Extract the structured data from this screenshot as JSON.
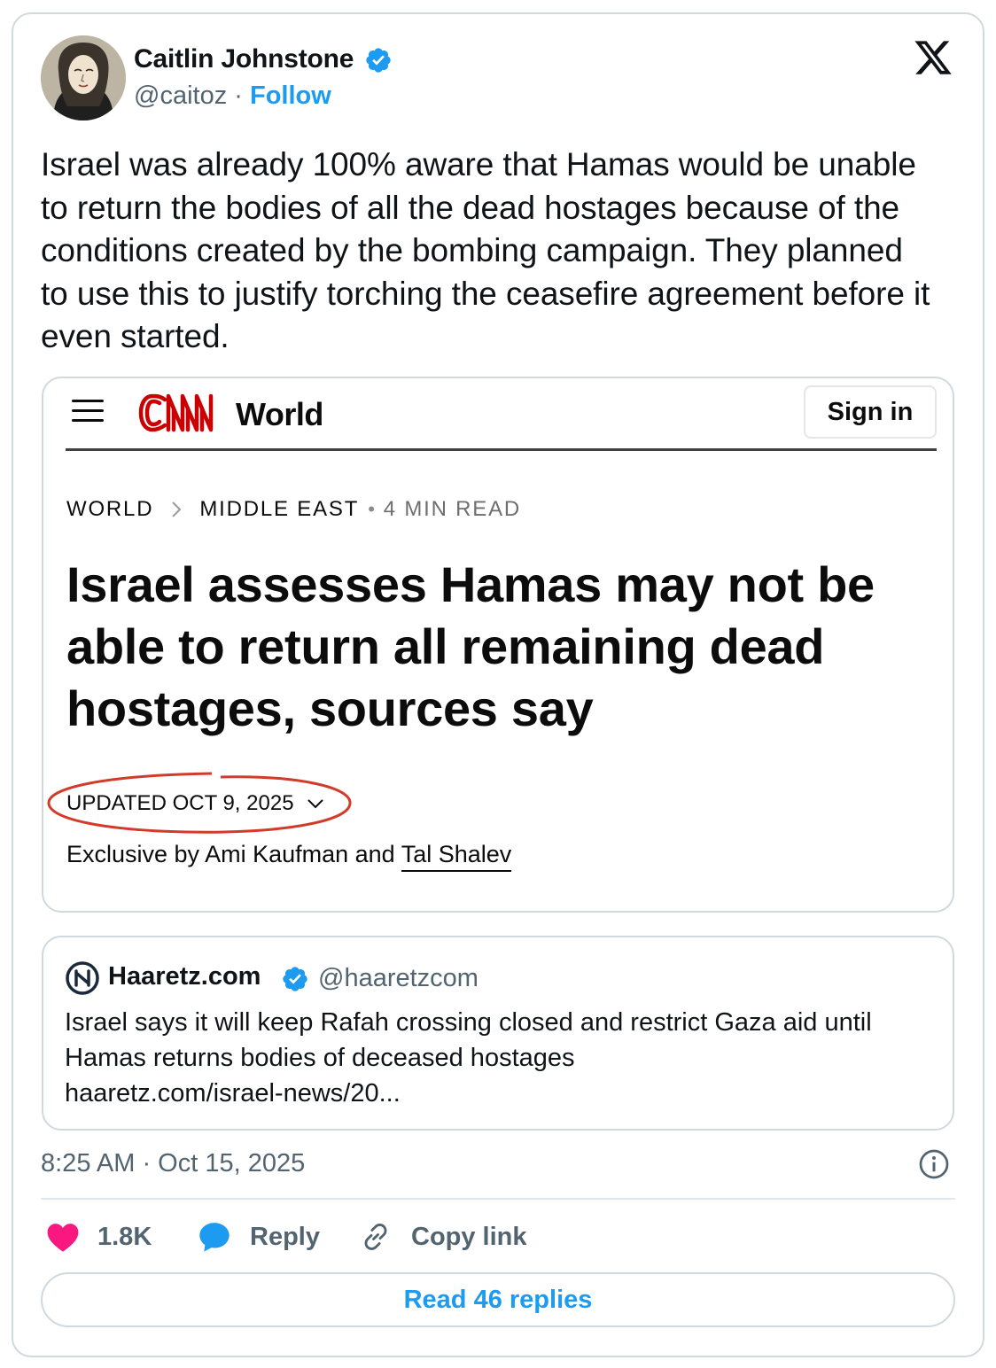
{
  "tweet": {
    "author": {
      "name": "Caitlin Johnstone",
      "handle": "@caitoz",
      "separator": "·",
      "follow_label": "Follow",
      "verified": true
    },
    "text": "Israel was already 100% aware that Hamas would be unable to return the bodies of all the dead hostages because of the conditions created by the bombing campaign. They planned to use this to justify torching the ceasefire agreement before it even started.",
    "timestamp": "8:25 AM · Oct 15, 2025",
    "actions": {
      "likes": "1.8K",
      "reply_label": "Reply",
      "copy_link_label": "Copy link"
    },
    "read_replies_label": "Read 46 replies"
  },
  "embedded_article": {
    "section": "World",
    "sign_in_label": "Sign in",
    "breadcrumb": [
      "WORLD",
      "MIDDLE EAST"
    ],
    "read_time": "4 MIN READ",
    "headline": "Israel assesses Hamas may not be able to return all remaining dead hostages, sources say",
    "updated": "UPDATED OCT 9, 2025",
    "byline_prefix": "Exclusive by Ami Kaufman and ",
    "byline_link": "Tal Shalev"
  },
  "quoted_tweet": {
    "name": "Haaretz.com",
    "handle": "@haaretzcom",
    "verified": true,
    "text_line1": "Israel says it will keep Rafah crossing closed and restrict Gaza aid until",
    "text_line2": "Hamas returns bodies of deceased hostages",
    "link": "haaretz.com/israel-news/20..."
  },
  "colors": {
    "accent": "#1d9bf0",
    "muted": "#536471",
    "like": "#f91880",
    "cnn_red": "#cc0000",
    "annotation_red": "#d23b2a"
  },
  "icons": [
    "x-logo-icon",
    "verified-badge-icon",
    "hamburger-menu-icon",
    "cnn-logo",
    "chevron-right-icon",
    "chevron-down-icon",
    "haaretz-logo-icon",
    "info-icon",
    "heart-icon",
    "reply-bubble-icon",
    "link-icon"
  ]
}
